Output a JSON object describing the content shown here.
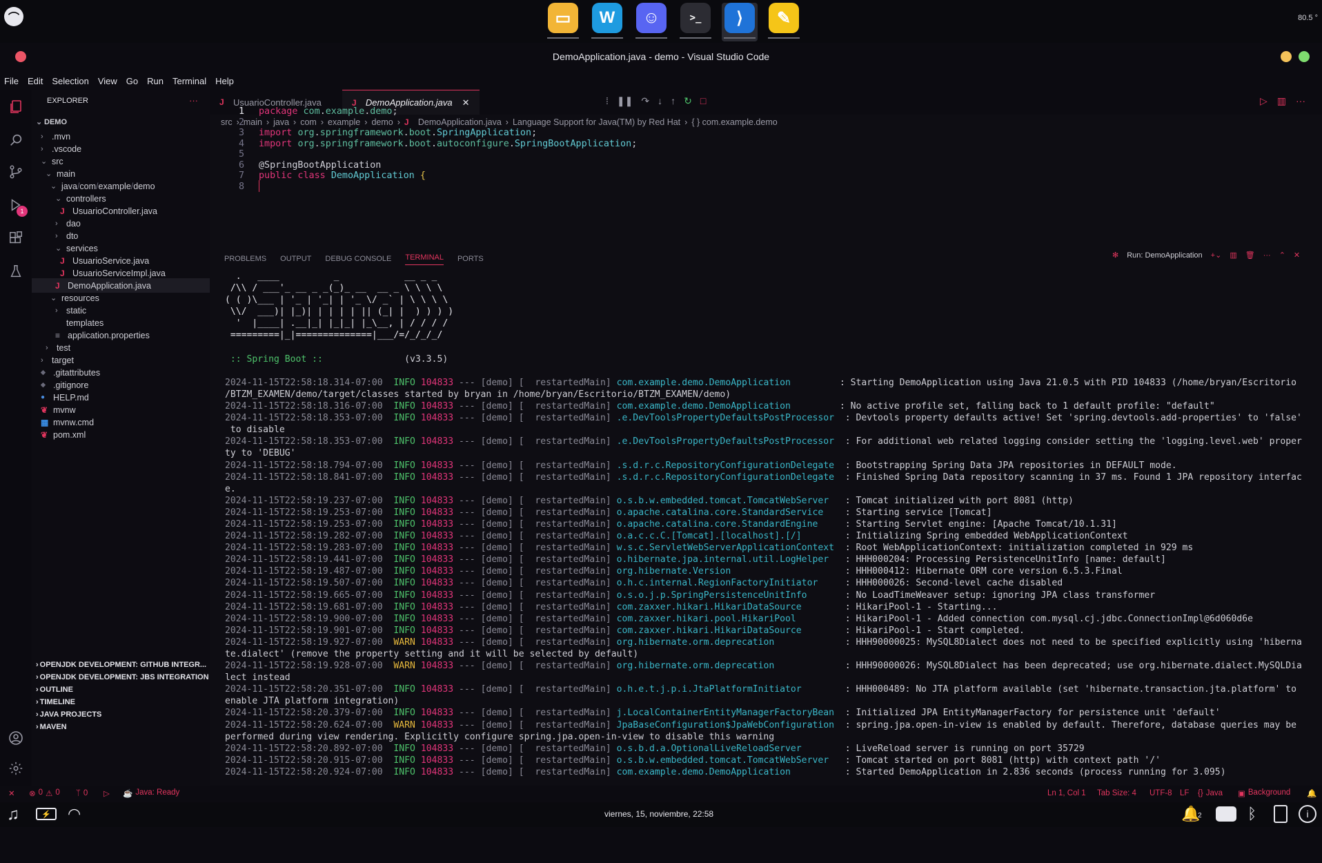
{
  "topbar": {
    "system_menu_icon": "ubuntu-circle-icon",
    "dock_apps": [
      {
        "name": "files-icon",
        "color": "#f2b536"
      },
      {
        "name": "windsurf-icon",
        "color": "#1e9be0"
      },
      {
        "name": "discord-icon",
        "color": "#5865f2"
      },
      {
        "name": "terminal-icon",
        "color": "#2c2c33"
      },
      {
        "name": "vscode-icon",
        "color": "#1f73d8"
      },
      {
        "name": "notes-icon",
        "color": "#f5c518"
      }
    ],
    "temperature": "80.5 °"
  },
  "window": {
    "title": "DemoApplication.java - demo - Visual Studio Code"
  },
  "menu": [
    "File",
    "Edit",
    "Selection",
    "View",
    "Go",
    "Run",
    "Terminal",
    "Help"
  ],
  "activity_badge": "1",
  "explorer": {
    "header": "EXPLORER",
    "more": "···",
    "root": "DEMO",
    "items": [
      {
        "label": ".mvn",
        "depth": 1,
        "type": "folder-closed"
      },
      {
        "label": ".vscode",
        "depth": 1,
        "type": "folder-closed"
      },
      {
        "label": "src",
        "depth": 1,
        "type": "folder-open"
      },
      {
        "label": "main",
        "depth": 2,
        "type": "folder-open"
      },
      {
        "label": "java",
        "depth": 3,
        "type": "folder-open",
        "compact": [
          "java",
          "com",
          "example",
          "demo"
        ]
      },
      {
        "label": "controllers",
        "depth": 4,
        "type": "folder-open"
      },
      {
        "label": "UsuarioController.java",
        "depth": 5,
        "type": "java"
      },
      {
        "label": "dao",
        "depth": 4,
        "type": "folder-closed"
      },
      {
        "label": "dto",
        "depth": 4,
        "type": "folder-closed"
      },
      {
        "label": "services",
        "depth": 4,
        "type": "folder-open"
      },
      {
        "label": "UsuarioService.java",
        "depth": 5,
        "type": "java"
      },
      {
        "label": "UsuarioServiceImpl.java",
        "depth": 5,
        "type": "java"
      },
      {
        "label": "DemoApplication.java",
        "depth": 4,
        "type": "java",
        "selected": true
      },
      {
        "label": "resources",
        "depth": 3,
        "type": "folder-open"
      },
      {
        "label": "static",
        "depth": 4,
        "type": "folder-closed"
      },
      {
        "label": "templates",
        "depth": 4,
        "type": "folder-empty"
      },
      {
        "label": "application.properties",
        "depth": 4,
        "type": "props"
      },
      {
        "label": "test",
        "depth": 2,
        "type": "folder-closed"
      },
      {
        "label": "target",
        "depth": 1,
        "type": "folder-closed"
      },
      {
        "label": ".gitattributes",
        "depth": 1,
        "type": "git"
      },
      {
        "label": ".gitignore",
        "depth": 1,
        "type": "git"
      },
      {
        "label": "HELP.md",
        "depth": 1,
        "type": "md"
      },
      {
        "label": "mvnw",
        "depth": 1,
        "type": "mvn"
      },
      {
        "label": "mvnw.cmd",
        "depth": 1,
        "type": "win"
      },
      {
        "label": "pom.xml",
        "depth": 1,
        "type": "mvn"
      }
    ],
    "sections": [
      "OPENJDK DEVELOPMENT: GITHUB INTEGR...",
      "OPENJDK DEVELOPMENT: JBS INTEGRATION",
      "OUTLINE",
      "TIMELINE",
      "JAVA PROJECTS",
      "MAVEN"
    ]
  },
  "tabs": [
    {
      "label": "UsuarioController.java",
      "active": false
    },
    {
      "label": "DemoApplication.java",
      "active": true
    }
  ],
  "breadcrumb": [
    "src",
    "main",
    "java",
    "com",
    "example",
    "demo",
    "DemoApplication.java",
    "Language Support for Java(TM) by Red Hat",
    "{ } com.example.demo"
  ],
  "code": [
    {
      "n": "1",
      "tokens": [
        [
          "kw",
          "package "
        ],
        [
          "pk",
          "com"
        ],
        [
          "an",
          "."
        ],
        [
          "pk",
          "example"
        ],
        [
          "an",
          "."
        ],
        [
          "pk",
          "demo"
        ],
        [
          "an",
          ";"
        ]
      ]
    },
    {
      "n": "2",
      "tokens": []
    },
    {
      "n": "3",
      "tokens": [
        [
          "kw",
          "import "
        ],
        [
          "pk",
          "org"
        ],
        [
          "an",
          "."
        ],
        [
          "pk",
          "springframework"
        ],
        [
          "an",
          "."
        ],
        [
          "pk",
          "boot"
        ],
        [
          "an",
          "."
        ],
        [
          "cls",
          "SpringApplication"
        ],
        [
          "an",
          ";"
        ]
      ]
    },
    {
      "n": "4",
      "tokens": [
        [
          "kw",
          "import "
        ],
        [
          "pk",
          "org"
        ],
        [
          "an",
          "."
        ],
        [
          "pk",
          "springframework"
        ],
        [
          "an",
          "."
        ],
        [
          "pk",
          "boot"
        ],
        [
          "an",
          "."
        ],
        [
          "pk",
          "autoconfigure"
        ],
        [
          "an",
          "."
        ],
        [
          "cls",
          "SpringBootApplication"
        ],
        [
          "an",
          ";"
        ]
      ]
    },
    {
      "n": "5",
      "tokens": []
    },
    {
      "n": "6",
      "tokens": [
        [
          "an",
          "@SpringBootApplication"
        ]
      ]
    },
    {
      "n": "7",
      "tokens": [
        [
          "kw",
          "public class "
        ],
        [
          "cls",
          "DemoApplication "
        ],
        [
          "br",
          "{"
        ]
      ]
    },
    {
      "n": "8",
      "tokens": []
    }
  ],
  "panel_tabs": [
    "PROBLEMS",
    "OUTPUT",
    "DEBUG CONSOLE",
    "TERMINAL",
    "PORTS"
  ],
  "panel_run_label": "Run: DemoApplication",
  "terminal": {
    "ascii": [
      "  .   ____          _            __ _ _",
      " /\\\\ / ___'_ __ _ _(_)_ __  __ _ \\ \\ \\ \\",
      "( ( )\\___ | '_ | '_| | '_ \\/ _` | \\ \\ \\ \\",
      " \\\\/  ___)| |_)| | | | | || (_| |  ) ) ) )",
      "  '  |____| .__|_| |_|_| |_\\__, | / / / /",
      " =========|_|==============|___/=/_/_/_/"
    ],
    "boot_label": " :: Spring Boot ::",
    "boot_version": "               (v3.3.5)",
    "logs": [
      {
        "ts": "2024-11-15T22:58:18.314-07:00",
        "lvl": "INFO",
        "pid": "104833",
        "thread": " --- [demo] [  restartedMain] ",
        "logger": "com.example.demo.DemoApplication        ",
        "msg": " : Starting DemoApplication using Java 21.0.5 with PID 104833 (/home/bryan/Escritorio",
        "cont": "/BTZM_EXAMEN/demo/target/classes started by bryan in /home/bryan/Escritorio/BTZM_EXAMEN/demo)"
      },
      {
        "ts": "2024-11-15T22:58:18.316-07:00",
        "lvl": "INFO",
        "pid": "104833",
        "thread": " --- [demo] [  restartedMain] ",
        "logger": "com.example.demo.DemoApplication        ",
        "msg": " : No active profile set, falling back to 1 default profile: \"default\""
      },
      {
        "ts": "2024-11-15T22:58:18.353-07:00",
        "lvl": "INFO",
        "pid": "104833",
        "thread": " --- [demo] [  restartedMain] ",
        "logger": ".e.DevToolsPropertyDefaultsPostProcessor ",
        "msg": " : Devtools property defaults active! Set 'spring.devtools.add-properties' to 'false'",
        "cont": " to disable"
      },
      {
        "ts": "2024-11-15T22:58:18.353-07:00",
        "lvl": "INFO",
        "pid": "104833",
        "thread": " --- [demo] [  restartedMain] ",
        "logger": ".e.DevToolsPropertyDefaultsPostProcessor ",
        "msg": " : For additional web related logging consider setting the 'logging.level.web' proper",
        "cont": "ty to 'DEBUG'"
      },
      {
        "ts": "2024-11-15T22:58:18.794-07:00",
        "lvl": "INFO",
        "pid": "104833",
        "thread": " --- [demo] [  restartedMain] ",
        "logger": ".s.d.r.c.RepositoryConfigurationDelegate ",
        "msg": " : Bootstrapping Spring Data JPA repositories in DEFAULT mode."
      },
      {
        "ts": "2024-11-15T22:58:18.841-07:00",
        "lvl": "INFO",
        "pid": "104833",
        "thread": " --- [demo] [  restartedMain] ",
        "logger": ".s.d.r.c.RepositoryConfigurationDelegate ",
        "msg": " : Finished Spring Data repository scanning in 37 ms. Found 1 JPA repository interfac",
        "cont": "e."
      },
      {
        "ts": "2024-11-15T22:58:19.237-07:00",
        "lvl": "INFO",
        "pid": "104833",
        "thread": " --- [demo] [  restartedMain] ",
        "logger": "o.s.b.w.embedded.tomcat.TomcatWebServer  ",
        "msg": " : Tomcat initialized with port 8081 (http)"
      },
      {
        "ts": "2024-11-15T22:58:19.253-07:00",
        "lvl": "INFO",
        "pid": "104833",
        "thread": " --- [demo] [  restartedMain] ",
        "logger": "o.apache.catalina.core.StandardService   ",
        "msg": " : Starting service [Tomcat]"
      },
      {
        "ts": "2024-11-15T22:58:19.253-07:00",
        "lvl": "INFO",
        "pid": "104833",
        "thread": " --- [demo] [  restartedMain] ",
        "logger": "o.apache.catalina.core.StandardEngine    ",
        "msg": " : Starting Servlet engine: [Apache Tomcat/10.1.31]"
      },
      {
        "ts": "2024-11-15T22:58:19.282-07:00",
        "lvl": "INFO",
        "pid": "104833",
        "thread": " --- [demo] [  restartedMain] ",
        "logger": "o.a.c.c.C.[Tomcat].[localhost].[/]       ",
        "msg": " : Initializing Spring embedded WebApplicationContext"
      },
      {
        "ts": "2024-11-15T22:58:19.283-07:00",
        "lvl": "INFO",
        "pid": "104833",
        "thread": " --- [demo] [  restartedMain] ",
        "logger": "w.s.c.ServletWebServerApplicationContext ",
        "msg": " : Root WebApplicationContext: initialization completed in 929 ms"
      },
      {
        "ts": "2024-11-15T22:58:19.441-07:00",
        "lvl": "INFO",
        "pid": "104833",
        "thread": " --- [demo] [  restartedMain] ",
        "logger": "o.hibernate.jpa.internal.util.LogHelper  ",
        "msg": " : HHH000204: Processing PersistenceUnitInfo [name: default]"
      },
      {
        "ts": "2024-11-15T22:58:19.487-07:00",
        "lvl": "INFO",
        "pid": "104833",
        "thread": " --- [demo] [  restartedMain] ",
        "logger": "org.hibernate.Version                    ",
        "msg": " : HHH000412: Hibernate ORM core version 6.5.3.Final"
      },
      {
        "ts": "2024-11-15T22:58:19.507-07:00",
        "lvl": "INFO",
        "pid": "104833",
        "thread": " --- [demo] [  restartedMain] ",
        "logger": "o.h.c.internal.RegionFactoryInitiator    ",
        "msg": " : HHH000026: Second-level cache disabled"
      },
      {
        "ts": "2024-11-15T22:58:19.665-07:00",
        "lvl": "INFO",
        "pid": "104833",
        "thread": " --- [demo] [  restartedMain] ",
        "logger": "o.s.o.j.p.SpringPersistenceUnitInfo      ",
        "msg": " : No LoadTimeWeaver setup: ignoring JPA class transformer"
      },
      {
        "ts": "2024-11-15T22:58:19.681-07:00",
        "lvl": "INFO",
        "pid": "104833",
        "thread": " --- [demo] [  restartedMain] ",
        "logger": "com.zaxxer.hikari.HikariDataSource       ",
        "msg": " : HikariPool-1 - Starting..."
      },
      {
        "ts": "2024-11-15T22:58:19.900-07:00",
        "lvl": "INFO",
        "pid": "104833",
        "thread": " --- [demo] [  restartedMain] ",
        "logger": "com.zaxxer.hikari.pool.HikariPool        ",
        "msg": " : HikariPool-1 - Added connection com.mysql.cj.jdbc.ConnectionImpl@6d060d6e"
      },
      {
        "ts": "2024-11-15T22:58:19.901-07:00",
        "lvl": "INFO",
        "pid": "104833",
        "thread": " --- [demo] [  restartedMain] ",
        "logger": "com.zaxxer.hikari.HikariDataSource       ",
        "msg": " : HikariPool-1 - Start completed."
      },
      {
        "ts": "2024-11-15T22:58:19.927-07:00",
        "lvl": "WARN",
        "pid": "104833",
        "thread": " --- [demo] [  restartedMain] ",
        "logger": "org.hibernate.orm.deprecation            ",
        "msg": " : HHH90000025: MySQL8Dialect does not need to be specified explicitly using 'hiberna",
        "cont": "te.dialect' (remove the property setting and it will be selected by default)"
      },
      {
        "ts": "2024-11-15T22:58:19.928-07:00",
        "lvl": "WARN",
        "pid": "104833",
        "thread": " --- [demo] [  restartedMain] ",
        "logger": "org.hibernate.orm.deprecation            ",
        "msg": " : HHH90000026: MySQL8Dialect has been deprecated; use org.hibernate.dialect.MySQLDia",
        "cont": "lect instead"
      },
      {
        "ts": "2024-11-15T22:58:20.351-07:00",
        "lvl": "INFO",
        "pid": "104833",
        "thread": " --- [demo] [  restartedMain] ",
        "logger": "o.h.e.t.j.p.i.JtaPlatformInitiator       ",
        "msg": " : HHH000489: No JTA platform available (set 'hibernate.transaction.jta.platform' to",
        "cont": "enable JTA platform integration)"
      },
      {
        "ts": "2024-11-15T22:58:20.379-07:00",
        "lvl": "INFO",
        "pid": "104833",
        "thread": " --- [demo] [  restartedMain] ",
        "logger": "j.LocalContainerEntityManagerFactoryBean ",
        "msg": " : Initialized JPA EntityManagerFactory for persistence unit 'default'"
      },
      {
        "ts": "2024-11-15T22:58:20.624-07:00",
        "lvl": "WARN",
        "pid": "104833",
        "thread": " --- [demo] [  restartedMain] ",
        "logger": "JpaBaseConfiguration$JpaWebConfiguration ",
        "msg": " : spring.jpa.open-in-view is enabled by default. Therefore, database queries may be",
        "cont": "performed during view rendering. Explicitly configure spring.jpa.open-in-view to disable this warning"
      },
      {
        "ts": "2024-11-15T22:58:20.892-07:00",
        "lvl": "INFO",
        "pid": "104833",
        "thread": " --- [demo] [  restartedMain] ",
        "logger": "o.s.b.d.a.OptionalLiveReloadServer       ",
        "msg": " : LiveReload server is running on port 35729"
      },
      {
        "ts": "2024-11-15T22:58:20.915-07:00",
        "lvl": "INFO",
        "pid": "104833",
        "thread": " --- [demo] [  restartedMain] ",
        "logger": "o.s.b.w.embedded.tomcat.TomcatWebServer  ",
        "msg": " : Tomcat started on port 8081 (http) with context path '/'"
      },
      {
        "ts": "2024-11-15T22:58:20.924-07:00",
        "lvl": "INFO",
        "pid": "104833",
        "thread": " --- [demo] [  restartedMain] ",
        "logger": "com.example.demo.DemoApplication         ",
        "msg": " : Started DemoApplication in 2.836 seconds (process running for 3.095)"
      }
    ]
  },
  "status": {
    "errors": "0",
    "warnings": "0",
    "ports": "0",
    "java_status": "Java: Ready",
    "position": "Ln 1, Col 1",
    "tab_size": "Tab Size: 4",
    "encoding": "UTF-8",
    "eol": "LF",
    "language": "Java",
    "background": "Background"
  },
  "taskbar": {
    "clock": "viernes,  15,  noviembre, 22:58",
    "notif_count": "2"
  }
}
